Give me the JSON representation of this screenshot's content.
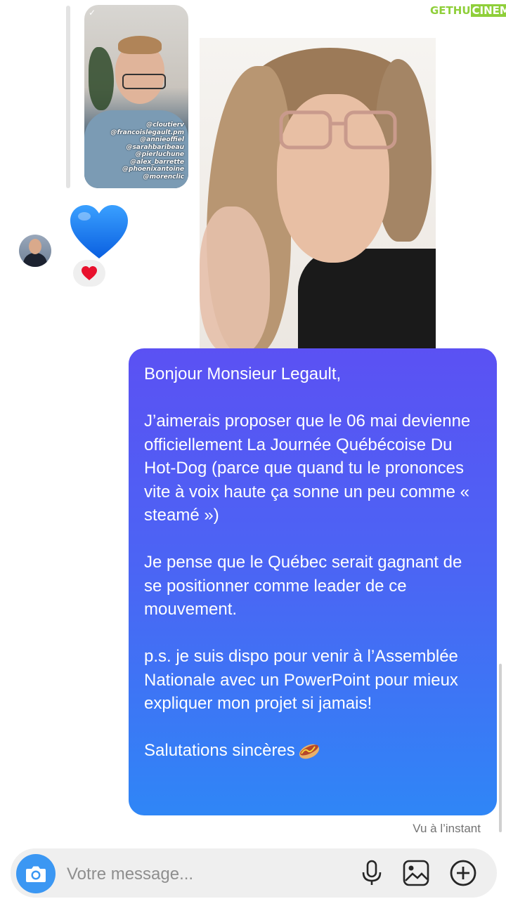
{
  "story": {
    "mentions": [
      "@cloutierv",
      "@francoislegault.pm",
      "@annieoffiel",
      "@sarahbaribeau",
      "@pierluchune",
      "@alex_barrette",
      "@phoenixantoine",
      "@morenclic"
    ]
  },
  "reaction": {
    "main_emoji": "blue-heart",
    "badge_emoji": "red-heart"
  },
  "message": {
    "paragraphs": [
      "Bonjour Monsieur Legault,",
      "J’aimerais proposer que le 06 mai devienne officiellement La Journée Québécoise Du Hot-Dog (parce que quand tu le prononces vite à voix haute ça sonne un peu comme « steamé »)",
      "Je pense que le Québec serait gagnant de se positionner comme leader de ce mouvement.",
      "p.s. je suis dispo pour venir à l’Assemblée Nationale avec un PowerPoint pour mieux expliquer mon projet si jamais!",
      "Salutations sincères"
    ],
    "closing_emoji": "hotdog",
    "status": "Vu à l’instant"
  },
  "composer": {
    "placeholder": "Votre message..."
  },
  "watermark": {
    "part1": "GETHU",
    "part2": "CINEMA"
  },
  "colors": {
    "bubble_top": "#5b51f3",
    "bubble_bottom": "#2f86f6",
    "camera_button": "#3b97f3",
    "composer_bg": "#efefef"
  }
}
